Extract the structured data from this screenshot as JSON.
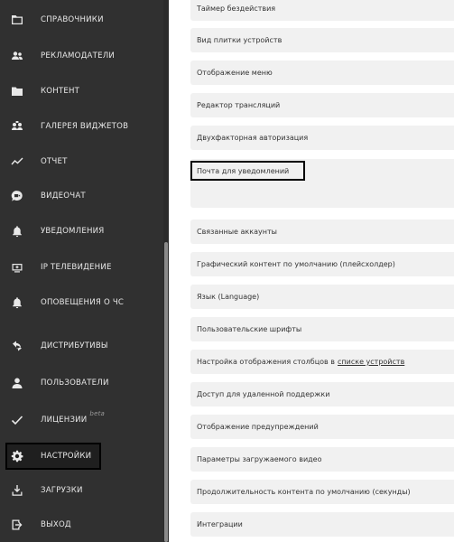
{
  "sidebar": {
    "items": [
      {
        "label": "СПРАВОЧНИКИ",
        "icon": "folder-outline-icon"
      },
      {
        "label": "РЕКЛАМОДАТЕЛИ",
        "icon": "users-icon"
      },
      {
        "label": "КОНТЕНТ",
        "icon": "folder-filled-icon"
      },
      {
        "label": "ГАЛЕРЕЯ ВИДЖЕТОВ",
        "icon": "widgets-gallery-icon"
      },
      {
        "label": "ОТЧЕТ",
        "icon": "chart-line-icon"
      },
      {
        "label": "ВИДЕОЧАТ",
        "icon": "video-chat-icon"
      },
      {
        "label": "УВЕДОМЛЕНИЯ",
        "icon": "bell-icon"
      },
      {
        "label": "IP ТЕЛЕВИДЕНИЕ",
        "icon": "tv-icon"
      },
      {
        "label": "ОПОВЕЩЕНИЯ О ЧС",
        "icon": "bell-alert-icon"
      },
      {
        "label": "ДИСТРИБУТИВЫ",
        "icon": "distributives-icon"
      },
      {
        "label": "ПОЛЬЗОВАТЕЛИ",
        "icon": "user-icon"
      },
      {
        "label": "ЛИЦЕНЗИИ",
        "icon": "check-icon",
        "badge": "beta"
      },
      {
        "label": "НАСТРОЙКИ",
        "icon": "gear-icon"
      },
      {
        "label": "ЗАГРУЗКИ",
        "icon": "download-icon"
      },
      {
        "label": "ВЫХОД",
        "icon": "logout-icon"
      }
    ],
    "active": "НАСТРОЙКИ"
  },
  "settings": {
    "rows": [
      {
        "label": "Таймер бездействия"
      },
      {
        "label": "Вид плитки устройств"
      },
      {
        "label": "Отображение меню"
      },
      {
        "label": "Редактор трансляций"
      },
      {
        "label": "Двухфакторная авторизация"
      },
      {
        "label": "Почта для уведомлений"
      },
      {
        "label": "Связанные аккаунты"
      },
      {
        "label": "Графический контент по умолчанию (плейсхолдер)"
      },
      {
        "label": "Язык (Language)"
      },
      {
        "label": "Пользовательские шрифты"
      },
      {
        "label": "Настройка отображения столбцов в",
        "link": "списке устройств"
      },
      {
        "label": "Доступ для удаленной поддержки"
      },
      {
        "label": "Отображение предупреждений"
      },
      {
        "label": "Параметры загружаемого видео"
      },
      {
        "label": "Продолжительность контента по умолчанию (секунды)"
      },
      {
        "label": "Интеграции"
      }
    ]
  }
}
